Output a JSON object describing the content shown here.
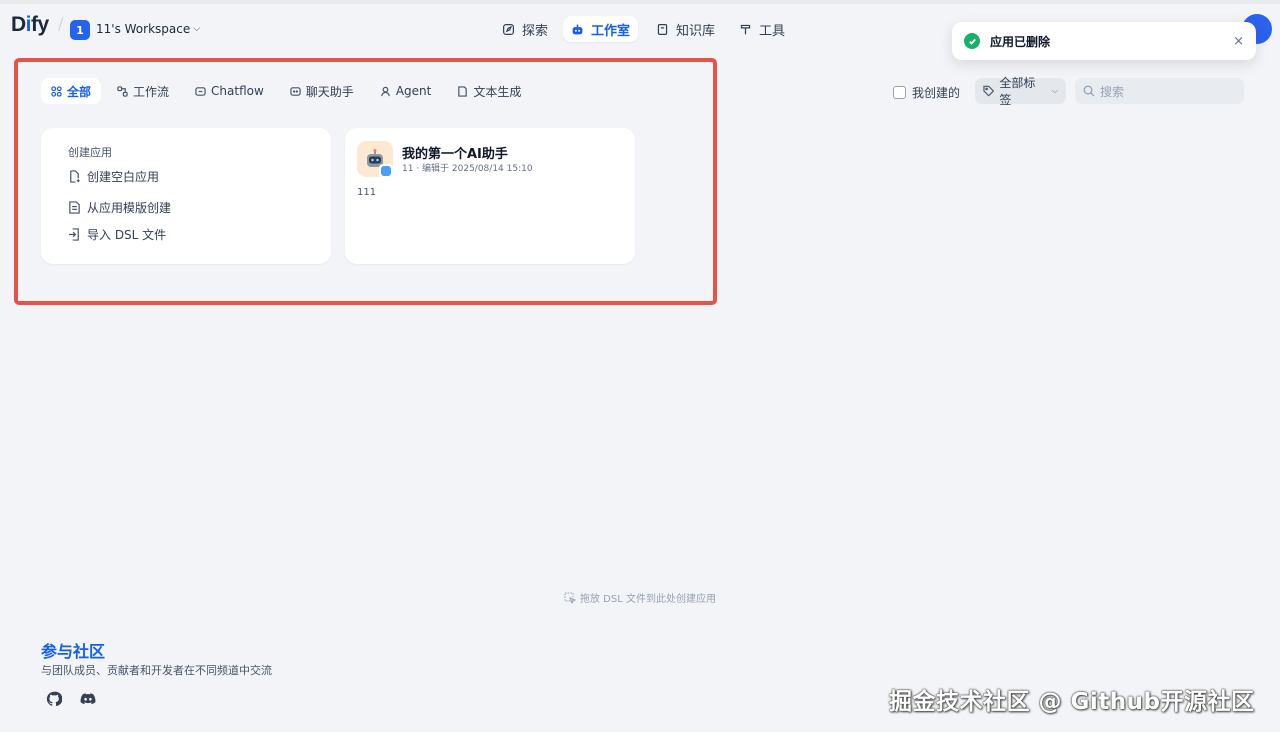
{
  "header": {
    "logo": {
      "text_a": "D",
      "text_i": "i",
      "text_b": "fy"
    },
    "workspace": {
      "badge": "1",
      "name": "11's Workspace"
    },
    "nav": [
      {
        "label": "探索",
        "icon": "compass-icon"
      },
      {
        "label": "工作室",
        "icon": "robot-icon",
        "active": true
      },
      {
        "label": "知识库",
        "icon": "book-icon"
      },
      {
        "label": "工具",
        "icon": "hammer-icon"
      }
    ]
  },
  "toast": {
    "message": "应用已删除",
    "close": "×",
    "icon": "check-circle-icon",
    "color": "#17b26a"
  },
  "filters": {
    "tabs": [
      {
        "label": "全部",
        "icon": "grid-icon",
        "active": true
      },
      {
        "label": "工作流",
        "icon": "workflow-icon"
      },
      {
        "label": "Chatflow",
        "icon": "chatflow-icon"
      },
      {
        "label": "聊天助手",
        "icon": "chat-bubble-icon"
      },
      {
        "label": "Agent",
        "icon": "agent-icon"
      },
      {
        "label": "文本生成",
        "icon": "document-icon"
      }
    ],
    "created_by_me": "我创建的",
    "tags_select": "全部标签",
    "search_placeholder": "搜索"
  },
  "create_card": {
    "title": "创建应用",
    "items": [
      {
        "label": "创建空白应用",
        "icon": "file-plus-icon"
      },
      {
        "label": "从应用模版创建",
        "icon": "file-template-icon"
      },
      {
        "label": "导入 DSL 文件",
        "icon": "file-import-icon"
      }
    ]
  },
  "apps": [
    {
      "name": "我的第一个AI助手",
      "meta": "11 · 编辑于 2025/08/14 15:10",
      "description": "111",
      "icon": "robot-emoji-icon"
    }
  ],
  "dsl_hint": "拖放 DSL 文件到此处创建应用",
  "community": {
    "title": "参与社区",
    "description": "与团队成员、贡献者和开发者在不同频道中交流",
    "links": [
      "github-icon",
      "discord-icon"
    ]
  },
  "watermark": "掘金技术社区 @ Github开源社区",
  "colors": {
    "accent": "#155eef",
    "highlight_border": "#e5534b",
    "background": "#f2f4f7"
  }
}
